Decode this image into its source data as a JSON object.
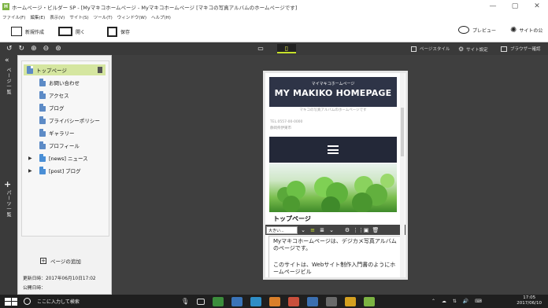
{
  "window": {
    "title": "ホームページ・ビルダー SP - [Myマキコホームページ - Myマキコホームページ [マキコの写真アルバムのホームページです]",
    "app_icon": "hpb-app-icon",
    "controls": [
      "—",
      "▢",
      "✕"
    ]
  },
  "menubar": {
    "items": [
      "ファイル(F)",
      "編集(E)",
      "表示(V)",
      "サイト(S)",
      "ツール(T)",
      "ウィンドウ(W)",
      "ヘルプ(H)"
    ]
  },
  "toolbar": {
    "new_label": "新規作成",
    "open_label": "開く",
    "save_label": "保存",
    "preview_label": "プレビュー",
    "site_label": "サイトの公"
  },
  "viewbar": {
    "page_style_label": "ページスタイル",
    "site_settings_label": "サイト設定",
    "browser_check_label": "ブラウザー確認"
  },
  "leftstrip": {
    "collapse": "«",
    "page_list_label": "ページ一覧",
    "add": "+",
    "parts_label": "パーツ一覧"
  },
  "sidebar": {
    "pages": [
      {
        "label": "トップページ",
        "selected": true
      },
      {
        "label": "お問い合わせ"
      },
      {
        "label": "アクセス"
      },
      {
        "label": "ブログ"
      },
      {
        "label": "プライバシーポリシー"
      },
      {
        "label": "ギャラリー"
      },
      {
        "label": "プロフィール"
      },
      {
        "label": "[news] ニュース"
      },
      {
        "label": "[post] ブログ"
      }
    ],
    "add_page_label": "ページの追加",
    "updated_label": "更新日時：2017年06月10日17:02",
    "published_label": "公開日時："
  },
  "preview": {
    "header_sub": "マイマキコホームページ",
    "header_title": "MY MAKIKO HOMEPAGE",
    "tagline": "マキコの写真アルバムのホームページです",
    "tel": "TEL.0557-00-0000",
    "address": "静岡県伊東市",
    "section_title": "トップページ",
    "font_size_select": "大きい...",
    "text_1": "Myマキコホームページは、デジカメ写真アルバムのページです。",
    "text_2": "このサイトは、Webサイト制作入門書のようにホームページビル"
  },
  "taskbar": {
    "search_placeholder": "ここに入力して検索",
    "time": "17:05",
    "date": "2017/06/10"
  },
  "colors": {
    "accent": "#c6e02a",
    "header_bg": "#2e3447",
    "nav_bg": "#232838",
    "selected_row": "#d5e6a0"
  }
}
